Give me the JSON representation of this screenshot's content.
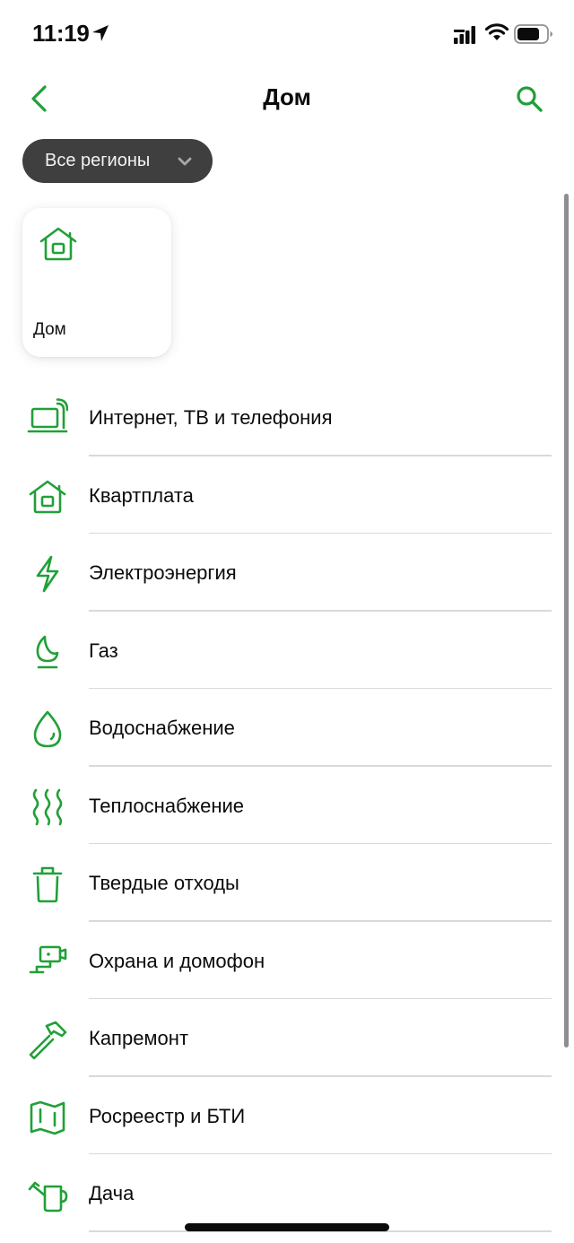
{
  "status_bar": {
    "time": "11:19",
    "icons": [
      "location-arrow-icon",
      "cellular-signal-icon",
      "wifi-icon",
      "battery-icon"
    ]
  },
  "nav": {
    "title": "Дом",
    "back_icon": "chevron-left-icon",
    "search_icon": "search-icon"
  },
  "region_filter": {
    "label": "Все регионы",
    "icon": "chevron-down-icon"
  },
  "selected_category": {
    "label": "Дом",
    "icon": "house-icon"
  },
  "categories": [
    {
      "label": "Интернет, ТВ и телефония",
      "icon": "laptop-signal-icon"
    },
    {
      "label": "Квартплата",
      "icon": "house-icon"
    },
    {
      "label": "Электроэнергия",
      "icon": "lightning-icon"
    },
    {
      "label": "Газ",
      "icon": "flame-icon"
    },
    {
      "label": "Водоснабжение",
      "icon": "water-drop-icon"
    },
    {
      "label": "Теплоснабжение",
      "icon": "heat-waves-icon"
    },
    {
      "label": "Твердые отходы",
      "icon": "trash-bin-icon"
    },
    {
      "label": "Охрана и домофон",
      "icon": "security-camera-icon"
    },
    {
      "label": "Капремонт",
      "icon": "hammer-icon"
    },
    {
      "label": "Росреестр и БТИ",
      "icon": "map-icon"
    },
    {
      "label": "Дача",
      "icon": "watering-can-icon"
    }
  ],
  "colors": {
    "accent": "#21a038",
    "chip_background": "#3f3f3f",
    "divider": "#d9d9d9",
    "text": "#0b0b0b"
  }
}
